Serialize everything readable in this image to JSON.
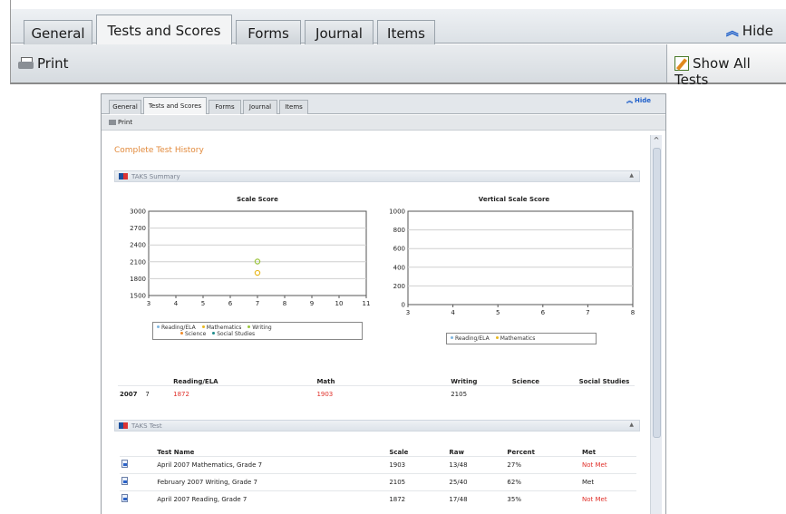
{
  "zoom": {
    "tabs": [
      "General",
      "Tests and Scores",
      "Forms",
      "Journal",
      "Items"
    ],
    "active_tab": "Tests and Scores",
    "hide_label": "Hide",
    "print_label": "Print",
    "show_all_label": "Show All Tests"
  },
  "window": {
    "tabs": [
      "General",
      "Tests and Scores",
      "Forms",
      "Journal",
      "Items"
    ],
    "hide_label": "Hide",
    "print_label": "Print",
    "page_title": "Complete Test History",
    "sections": {
      "summary": "TAKS Summary",
      "test": "TAKS Test"
    }
  },
  "chart_data": [
    {
      "type": "scatter",
      "title": "Scale Score",
      "x_ticks": [
        "3",
        "4",
        "5",
        "6",
        "7",
        "8",
        "9",
        "10",
        "11"
      ],
      "y_ticks": [
        "3000",
        "2700",
        "2400",
        "2100",
        "1800",
        "1500"
      ],
      "xlim": [
        3,
        11
      ],
      "ylim": [
        1500,
        3000
      ],
      "grid": true,
      "series": [
        {
          "name": "Reading/ELA",
          "color": "#7fb6e0",
          "points": []
        },
        {
          "name": "Mathematics",
          "color": "#e8b820",
          "points": [
            [
              7,
              1903
            ]
          ]
        },
        {
          "name": "Writing",
          "color": "#9ac43c",
          "points": [
            [
              7,
              2105
            ]
          ]
        },
        {
          "name": "Science",
          "color": "#f08a28",
          "points": []
        },
        {
          "name": "Social Studies",
          "color": "#1e8c8c",
          "points": []
        }
      ],
      "legend": "bottom"
    },
    {
      "type": "scatter",
      "title": "Vertical Scale Score",
      "x_ticks": [
        "3",
        "4",
        "5",
        "6",
        "7",
        "8"
      ],
      "y_ticks": [
        "1000",
        "800",
        "600",
        "400",
        "200",
        "0"
      ],
      "xlim": [
        3,
        8
      ],
      "ylim": [
        0,
        1000
      ],
      "grid": true,
      "series": [
        {
          "name": "Reading/ELA",
          "color": "#7fb6e0",
          "points": []
        },
        {
          "name": "Mathematics",
          "color": "#e8b820",
          "points": []
        }
      ],
      "legend": "bottom"
    }
  ],
  "summary_table": {
    "headers": [
      "Reading/ELA",
      "Math",
      "Writing",
      "Science",
      "Social Studies"
    ],
    "rows": [
      {
        "year": "2007",
        "grade": "7",
        "reading": "1872",
        "math": "1903",
        "writing": "2105",
        "science": "",
        "social": ""
      }
    ]
  },
  "test_table": {
    "headers": [
      "Test Name",
      "Scale",
      "Raw",
      "Percent",
      "Met"
    ],
    "rows": [
      {
        "name": "April 2007 Mathematics, Grade 7",
        "scale": "1903",
        "raw": "13/48",
        "percent": "27%",
        "met": "Not Met",
        "met_color": "#e0302a"
      },
      {
        "name": "February 2007 Writing, Grade 7",
        "scale": "2105",
        "raw": "25/40",
        "percent": "62%",
        "met": "Met",
        "met_color": "#222222"
      },
      {
        "name": "April 2007 Reading, Grade 7",
        "scale": "1872",
        "raw": "17/48",
        "percent": "35%",
        "met": "Not Met",
        "met_color": "#e0302a"
      }
    ]
  }
}
